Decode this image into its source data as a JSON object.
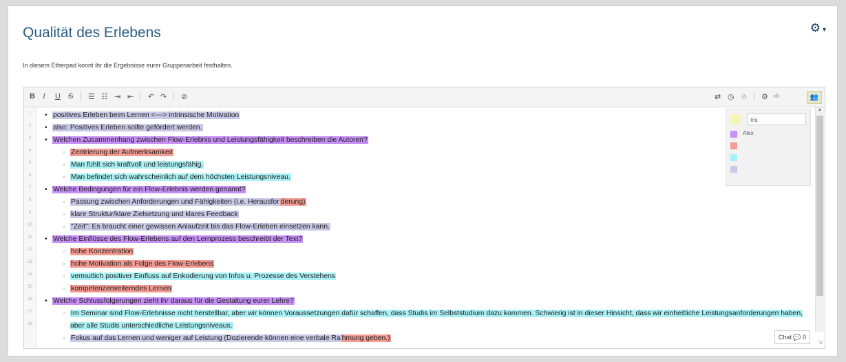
{
  "page": {
    "title": "Qualität des Erlebens",
    "intro": "In diesem Etherpad konnt ihr die Ergebnisse eurer Gruppenarbeit festhalten.",
    "settings_icon": "gear-icon"
  },
  "toolbar": {
    "bold": "B",
    "italic": "I",
    "underline": "U",
    "strike": "S",
    "ordered_list": "☰",
    "unordered_list": "☷",
    "indent": "⇥",
    "outdent": "⇤",
    "undo": "↶",
    "redo": "↷",
    "clear_authorship": "⊘",
    "import_export": "⇄",
    "timeslider": "◷",
    "star": "☆",
    "settings": "⚙",
    "embed": "‹/›",
    "users": "👥"
  },
  "colors": {
    "iris": "#f5f5b8",
    "alex": "#c690f5",
    "red": "#f49b93",
    "cyan": "#a9f1f5",
    "slate": "#c8c9e6"
  },
  "users": [
    {
      "name": "Iris",
      "color": "#f5f5b8"
    },
    {
      "name": "Alex",
      "color": "#c690f5"
    },
    {
      "name": "",
      "color": "#f49b93"
    },
    {
      "name": "",
      "color": "#a9f1f5"
    },
    {
      "name": "",
      "color": "#c8c9e6"
    }
  ],
  "line_numbers": [
    "1",
    "2",
    "3",
    "4",
    "5",
    "6",
    "7",
    "8",
    "9",
    "10",
    "11",
    "12",
    "13",
    "14",
    "15",
    "16",
    "17",
    "18"
  ],
  "lines": [
    {
      "level": 1,
      "segments": [
        {
          "text": "positives Erleben beim Lernen <---> intrinsische Motivation",
          "color": "#c8c9e6"
        }
      ]
    },
    {
      "level": 1,
      "segments": [
        {
          "text": "also: Positives Erleben sollte gefördert werden.",
          "color": "#c8c9e6"
        }
      ]
    },
    {
      "level": 1,
      "segments": [
        {
          "text": "Welchen Zusammenhang zwischen Flow-Erlebnis und Leistungsfähigkeit beschreiben die Autoren?",
          "color": "#c690f5"
        }
      ]
    },
    {
      "level": 2,
      "segments": [
        {
          "text": "Zentrierung der Aufmerksamkeit",
          "color": "#f49b93"
        }
      ]
    },
    {
      "level": 2,
      "segments": [
        {
          "text": "Man fühlt sich kraftvoll und leistungsfähig.",
          "color": "#a9f1f5"
        }
      ]
    },
    {
      "level": 2,
      "segments": [
        {
          "text": "Man befindet sich wahrscheinlich auf dem höchsten Leistungsniveau.",
          "color": "#a9f1f5"
        }
      ]
    },
    {
      "level": 1,
      "segments": [
        {
          "text": "Welche Bedingungen für ein Flow-Erlebnis werden genannt?",
          "color": "#c690f5"
        }
      ]
    },
    {
      "level": 2,
      "segments": [
        {
          "text": "Passung zwischen Anforderungen und Fähigkeiten (i.e. Herausfor",
          "color": "#c8c9e6"
        },
        {
          "text": "derung)",
          "color": "#f49b93"
        }
      ]
    },
    {
      "level": 2,
      "segments": [
        {
          "text": "klare Struktur/klare Zielsetzung und klares Feedback",
          "color": "#c8c9e6"
        }
      ]
    },
    {
      "level": 2,
      "segments": [
        {
          "text": "\"Zeit\": Es braucht einer gewissen Anlaufzeit bis das Flow-Erleben einsetzen kann.",
          "color": "#c8c9e6"
        }
      ]
    },
    {
      "level": 1,
      "segments": [
        {
          "text": "Welche Einflüsse des Flow-Erlebens auf den Lernprozess beschreibt der Text?",
          "color": "#c690f5"
        }
      ]
    },
    {
      "level": 2,
      "segments": [
        {
          "text": "hohe Konzentration",
          "color": "#f49b93"
        }
      ]
    },
    {
      "level": 2,
      "segments": [
        {
          "text": "hohe Motivation als Folge des Flow-Erlebens",
          "color": "#f49b93"
        }
      ]
    },
    {
      "level": 2,
      "segments": [
        {
          "text": "vermutlich positiver Einfluss auf Enkodierung von Infos u. Prozesse des Verstehens",
          "color": "#a9f1f5"
        }
      ]
    },
    {
      "level": 2,
      "segments": [
        {
          "text": "kompetenzerweiterndes Lernen",
          "color": "#f49b93"
        }
      ]
    },
    {
      "level": 1,
      "segments": [
        {
          "text": "Welche Schlussfolgerungen zieht ihr daraus für die Gestaltung eurer Lehre?",
          "color": "#c690f5"
        }
      ]
    },
    {
      "level": 2,
      "wrap": true,
      "segments": [
        {
          "text": "Im Seminar sind Flow-Erlebnisse nicht herstellbar, aber wir können Voraussetzungen dafür schaffen, dass Studis im Selbststudium dazu kommen. Schwierig ist in dieser Hinsicht, dass wir einheitliche Leistungsanforderungen haben, aber alle Studis unterschiedliche Leistungsniveaus.",
          "color": "#a9f1f5"
        }
      ]
    },
    {
      "level": 2,
      "segments": [
        {
          "text": "Fokus auf das Lernen und weniger auf Leistung (Dozierende können eine verbale Ra",
          "color": "#c8c9e6"
        },
        {
          "text": "hmung geben.)",
          "color": "#f49b93"
        }
      ]
    }
  ],
  "chat": {
    "label": "Chat",
    "count": "0"
  }
}
